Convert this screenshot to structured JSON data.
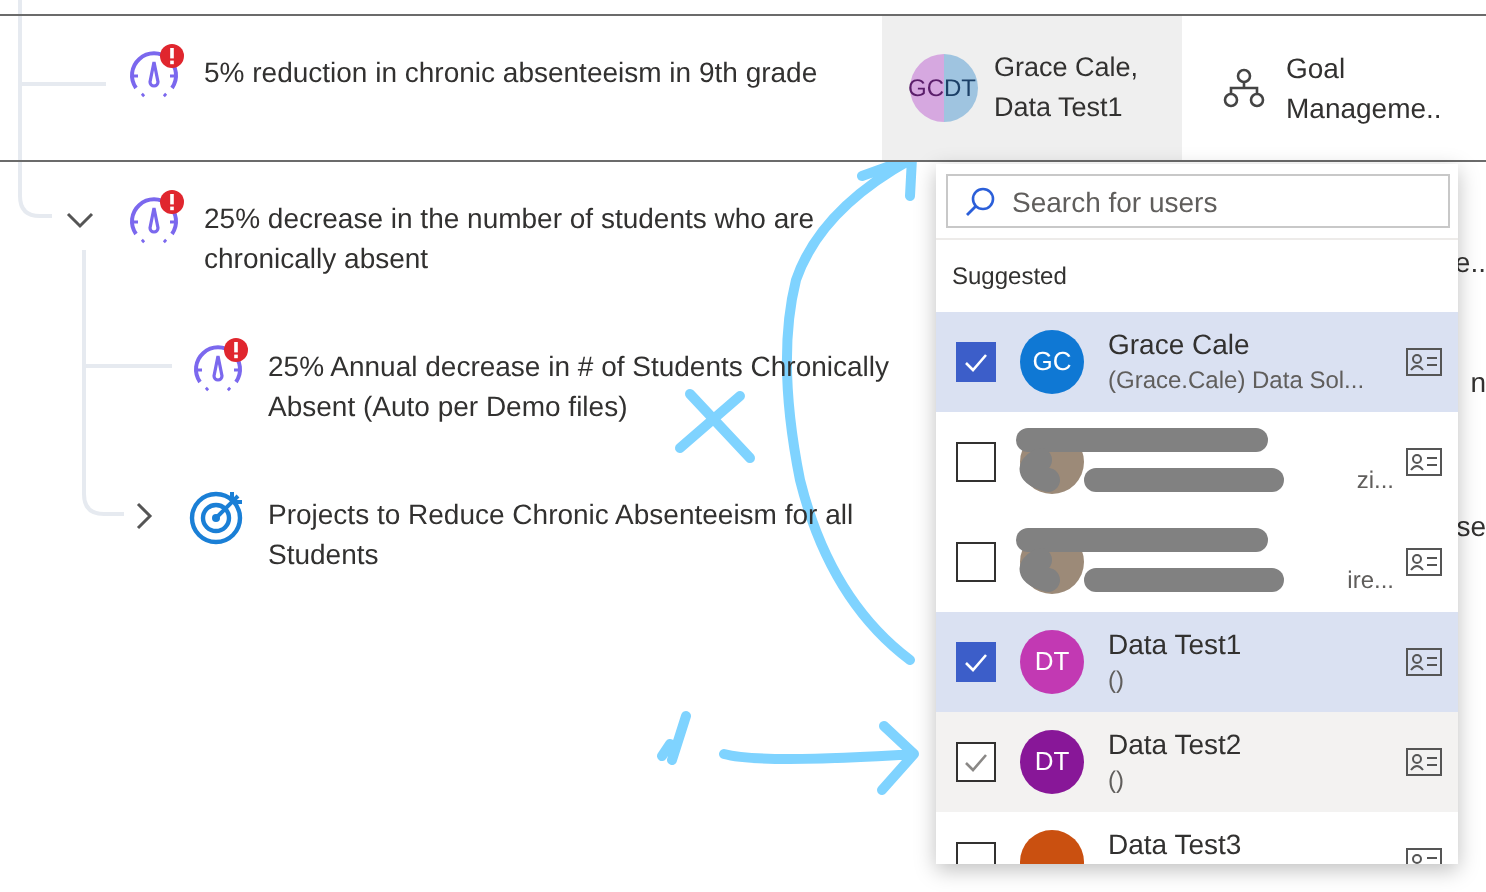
{
  "tree": [
    {
      "kind": "goal",
      "alert": true,
      "title": "5% reduction in chronic absenteeism in 9th grade"
    },
    {
      "kind": "goal",
      "alert": true,
      "expanded": true,
      "title": "25% decrease in the number of students who are chronically absent",
      "children": [
        {
          "kind": "goal",
          "alert": true,
          "title": "25% Annual decrease in # of Students Chronically Absent (Auto per Demo files)"
        },
        {
          "kind": "project",
          "alert": false,
          "expanded": false,
          "title": "Projects to Reduce Chronic Absenteeism for all Students"
        }
      ]
    }
  ],
  "first_row": {
    "assignee": {
      "avatar": [
        {
          "initials": "GC",
          "color": "#d6a8e0"
        },
        {
          "initials": "DT",
          "color": "#9fc4e0"
        }
      ],
      "text": "Grace Cale, Data Test1"
    },
    "column_3": "Goal Manageme.."
  },
  "column_tail": [
    "e..",
    "n",
    "se"
  ],
  "picker": {
    "search": {
      "placeholder": "Search for users"
    },
    "section": "Suggested",
    "users": [
      {
        "initials": "GC",
        "color": "#0f78d4",
        "name": "Grace Cale",
        "detail": "(Grace.Cale) Data Sol...",
        "checked": true,
        "hovered": false,
        "redacted": false
      },
      {
        "detail": "zi...",
        "checked": false,
        "hovered": false,
        "redacted": true
      },
      {
        "detail": "ire...",
        "checked": false,
        "hovered": false,
        "redacted": true
      },
      {
        "initials": "DT",
        "color": "#c239b3",
        "name": "Data Test1",
        "detail": "()",
        "checked": true,
        "hovered": false,
        "redacted": false
      },
      {
        "initials": "DT",
        "color": "#881798",
        "name": "Data Test2",
        "detail": "()",
        "checked": false,
        "hovered": true,
        "redacted": false
      },
      {
        "color": "#ca5010",
        "name": "Data Test3",
        "checked": false,
        "hovered": false,
        "redacted": false
      }
    ]
  },
  "annotations": [
    {
      "kind": "arrow"
    },
    {
      "kind": "cross"
    },
    {
      "kind": "tick"
    },
    {
      "kind": "arrow"
    }
  ]
}
